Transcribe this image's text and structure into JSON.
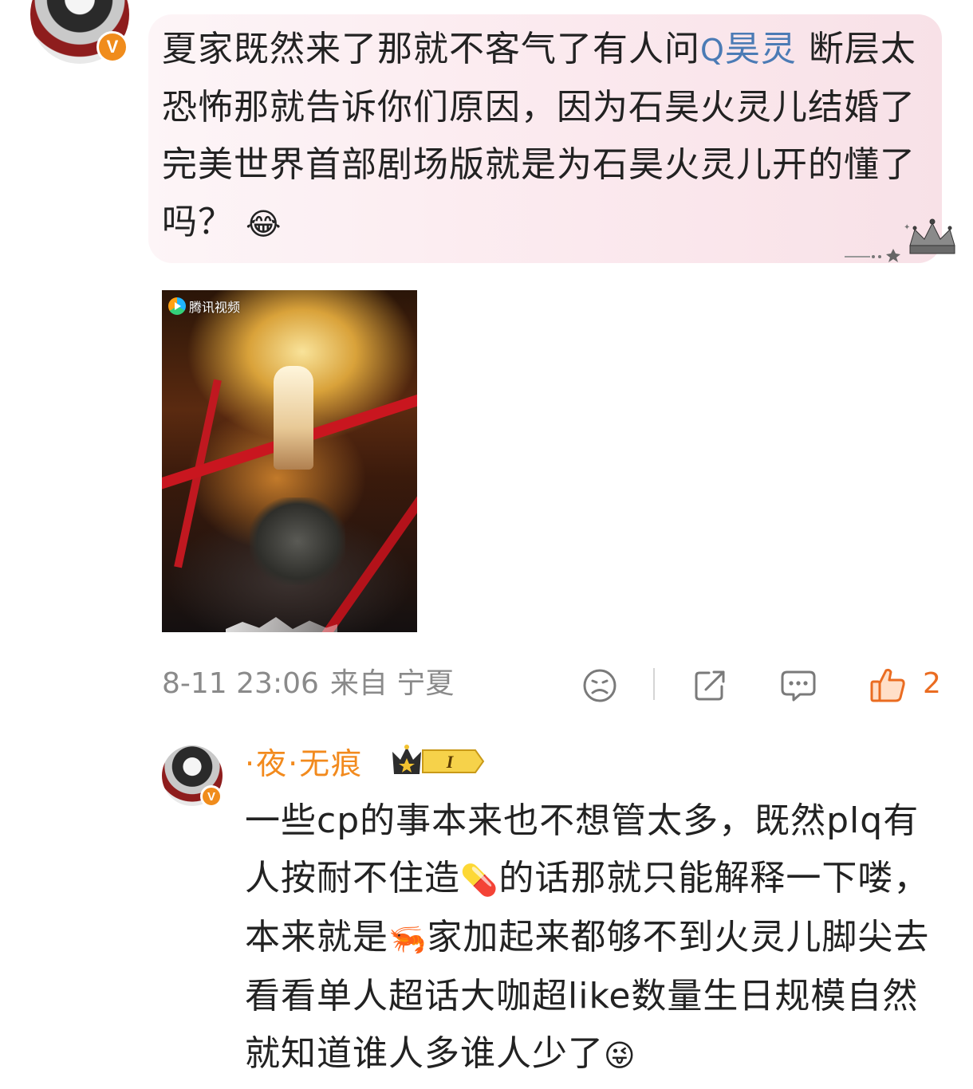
{
  "comment": {
    "avatar_icon": "user-avatar-icon",
    "badge_glyph": "V",
    "text_before_topic": "夏家既然来了那就不客气了有人问",
    "topic_search_glyph": "Q",
    "topic_label": "昊灵",
    "text_after_topic": " 断层太恐怖那就告诉你们原因，因为石昊火灵儿结婚了完美世界首部剧场版就是为石昊火灵儿开的懂了吗？",
    "emoji": "😂",
    "image": {
      "watermark": "腾讯视频",
      "icon": "tencent-video-logo-icon"
    },
    "date": "8-11 23:06",
    "source": "来自 宁夏",
    "actions": {
      "dislike_icon": "sad-face-icon",
      "share_icon": "share-icon",
      "comment_icon": "comment-icon",
      "like_icon": "thumbs-up-icon",
      "like_count": "2"
    }
  },
  "reply": {
    "username": "·夜·无痕",
    "level_badge": "I",
    "text_before_pill": "一些cp的事本来也不想管太多，既然plq有人按耐不住造",
    "pill_emoji": "💊",
    "text_mid": "的话那就只能解释一下喽，本来就是",
    "shrimp_emoji": "🦐",
    "text_after": "家加起来都够不到火灵儿脚尖去看看单人超话大咖超like数量生日规模自然就知道谁人多谁人少了",
    "end_emoji": "😜"
  },
  "colors": {
    "topic_blue": "#4b7bb5",
    "username_orange": "#f28a1d",
    "like_orange": "#ea6c21",
    "meta_gray": "#8a8a8a"
  }
}
